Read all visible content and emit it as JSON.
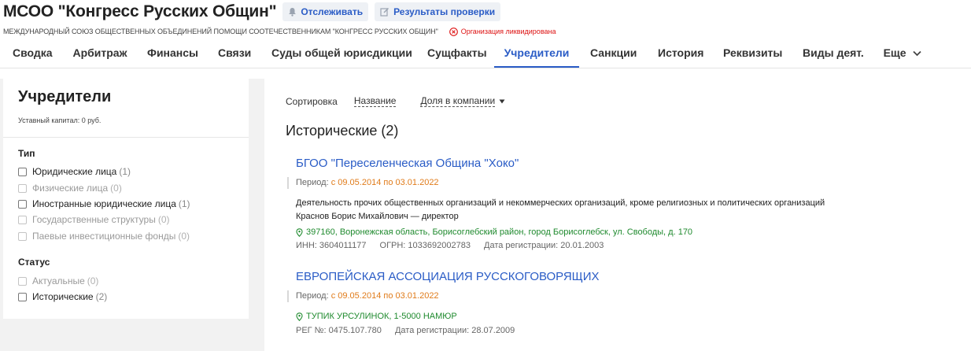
{
  "header": {
    "title": "МСОО \"Конгресс Русских Общин\"",
    "track_label": "Отслеживать",
    "check_label": "Результаты проверки",
    "full_name": "МЕЖДУНАРОДНЫЙ СОЮЗ ОБЩЕСТВЕННЫХ ОБЪЕДИНЕНИЙ ПОМОЩИ СООТЕЧЕСТВЕННИКАМ \"КОНГРЕСС РУССКИХ ОБЩИН\"",
    "status": "Организация ликвидирована",
    "status_color": "#dd1111"
  },
  "tabs": [
    {
      "label": "Сводка"
    },
    {
      "label": "Арбитраж"
    },
    {
      "label": "Финансы"
    },
    {
      "label": "Связи"
    },
    {
      "label": "Суды общей юрисдикции",
      "indicator": "green-dot"
    },
    {
      "label": "Сущфакты"
    },
    {
      "label": "Учредители",
      "active": true
    },
    {
      "label": "Санкции"
    },
    {
      "label": "История"
    },
    {
      "label": "Реквизиты"
    },
    {
      "label": "Виды деят."
    },
    {
      "label": "Еще",
      "icon": "chevron-down-icon"
    }
  ],
  "sidebar": {
    "title": "Учредители",
    "capital": "Уставный капитал: 0 руб.",
    "type_heading": "Тип",
    "type_filters": [
      {
        "label": "Юридические лица",
        "count": "(1)",
        "enabled": true
      },
      {
        "label": "Физические лица",
        "count": "(0)",
        "enabled": false
      },
      {
        "label": "Иностранные юридические лица",
        "count": "(1)",
        "enabled": true
      },
      {
        "label": "Государственные структуры",
        "count": "(0)",
        "enabled": false
      },
      {
        "label": "Паевые инвестиционные фонды",
        "count": "(0)",
        "enabled": false
      }
    ],
    "status_heading": "Статус",
    "status_filters": [
      {
        "label": "Актуальные",
        "count": "(0)",
        "enabled": false
      },
      {
        "label": "Исторические",
        "count": "(2)",
        "enabled": true
      }
    ]
  },
  "main": {
    "sort_label": "Сортировка",
    "sort_name": "Название",
    "sort_share": "Доля в компании",
    "section_title": "Исторические (2)",
    "entries": [
      {
        "name": "БГОО \"Переселенческая Община \"Хоко\"",
        "period_label": "Период:",
        "period": "с 09.05.2014 по 03.01.2022",
        "activity": "Деятельность прочих общественных организаций и некоммерческих организаций, кроме религиозных и политических организаций",
        "director": "Краснов Борис Михайлович — директор",
        "address": "397160, Воронежская область, Борисоглебский район, город Борисоглебск, ул. Свободы, д. 170",
        "ids": [
          "ИНН: 3604011177",
          "ОГРН: 1033692002783",
          "Дата регистрации: 20.01.2003"
        ]
      },
      {
        "name": "ЕВРОПЕЙСКАЯ АССОЦИАЦИЯ РУССКОГОВОРЯЩИХ",
        "period_label": "Период:",
        "period": "с 09.05.2014 по 03.01.2022",
        "address": "ТУПИК УРСУЛИНОК, 1-5000 НАМЮР",
        "ids": [
          "РЕГ №: 0475.107.780",
          "Дата регистрации: 28.07.2009"
        ]
      }
    ]
  },
  "colors": {
    "accent": "#2a5cc6",
    "period_dates": "#e07b1a",
    "address": "#1f8a2e",
    "indicator": "#2db84b"
  }
}
